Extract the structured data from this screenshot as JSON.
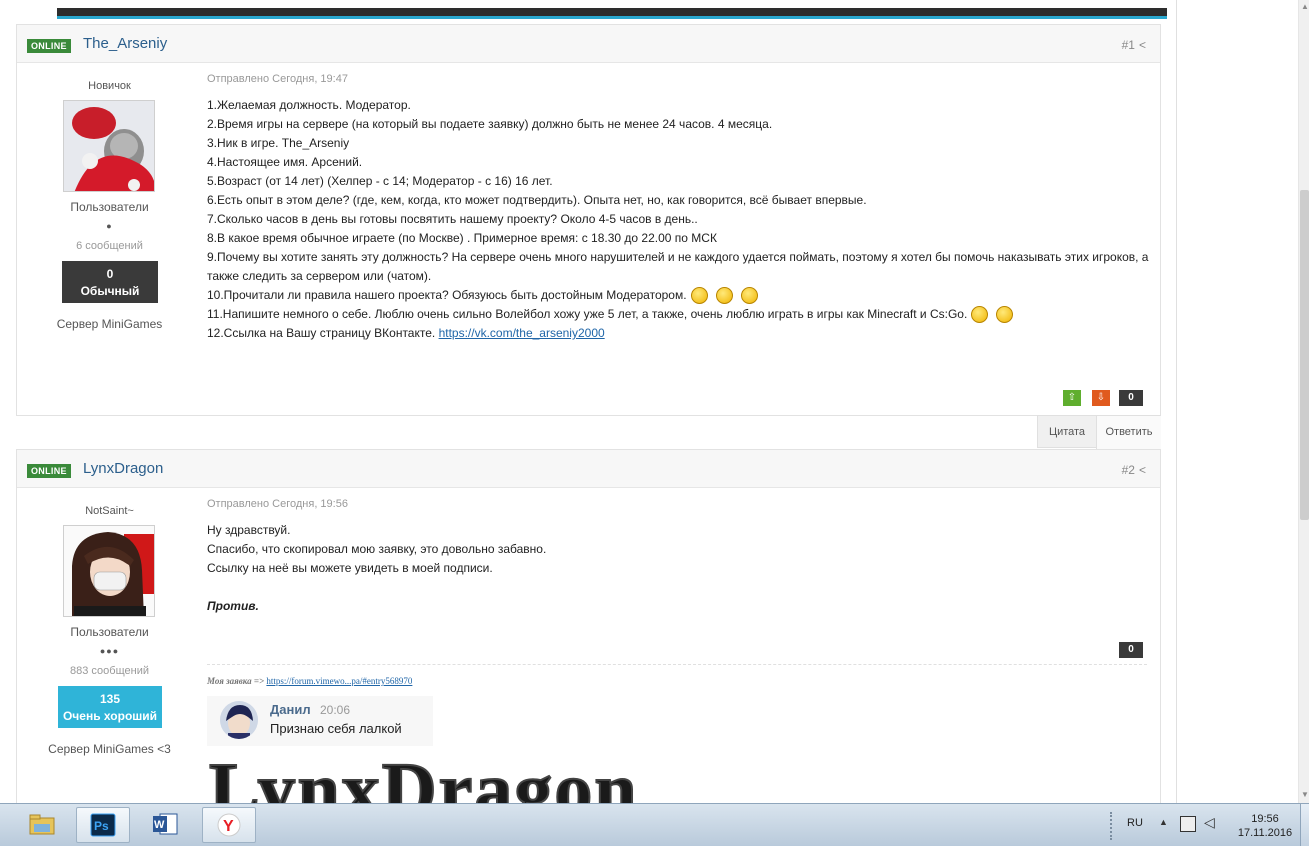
{
  "posts": [
    {
      "online": "ONLINE",
      "username": "The_Arseniy",
      "number": "#1",
      "rank": "Новичок",
      "group": "Пользователи",
      "pips": "●",
      "post_count": "6 сообщений",
      "rep_value": "0",
      "rep_label": "Обычный",
      "rep_color": "#3a3a3a",
      "server": "Сервер MiniGames",
      "posted": "Отправлено Сегодня, 19:47",
      "lines": [
        "1.Желаемая должность. Модератор.",
        "2.Время игры на сервере (на который вы подаете заявку) должно быть не менее 24 часов. 4 месяца.",
        "3.Ник в игре. The_Arseniy",
        "4.Настоящее имя. Арсений.",
        "5.Возраст (от 14 лет) (Хелпер - с 14; Модератор - с 16) 16 лет.",
        "6.Есть опыт в этом деле? (где, кем, когда, кто может подтвердить). Опыта нет, но, как говорится, всё бывает впервые.",
        "7.Сколько часов в день вы готовы посвятить нашему проекту? Около 4-5 часов в день..",
        "8.В какое время обычное играете (по Москве) . Примерное время: с 18.30 до 22.00 по МСК",
        "9.Почему вы хотите занять эту должность? На сервере очень много нарушителей и не каждого удается поймать, поэтому я хотел бы помочь наказывать этих игроков, а",
        "также следить за сервером или (чатом).",
        "10.Прочитали ли правила нашего проекта? Обязуюсь быть достойным Модератором.",
        "11.Напишите немного о себе. Люблю очень сильно Волейбол хожу уже 5 лет, а также, очень люблю играть в игры как Minecraft и Cs:Go."
      ],
      "line12_text": "12.Ссылка на Вашу страницу ВКонтакте. ",
      "line12_link": "https://vk.com/the_arseniy2000",
      "post_rep": "0",
      "vote_up": "⇧",
      "vote_down": "⇩"
    },
    {
      "online": "ONLINE",
      "username": "LynxDragon",
      "number": "#2",
      "rank": "NotSaint~",
      "group": "Пользователи",
      "pips": "●●●",
      "post_count": "883 сообщений",
      "rep_value": "135",
      "rep_label": "Очень хороший",
      "rep_color": "#2fb4d8",
      "server": "Сервер MiniGames <3",
      "posted": "Отправлено Сегодня, 19:56",
      "lines": [
        "Ну здравствуй.",
        "Спасибо, что скопировал мою заявку, это довольно забавно.",
        "Ссылку на неё вы можете увидеть в моей подписи."
      ],
      "bold": "Против.",
      "post_rep": "0",
      "sig_prefix": "Моя заявка => ",
      "sig_link": "https://forum.vimewo...pa/#entry568970",
      "sig_chat_name": "Данил",
      "sig_chat_time": "20:06",
      "sig_chat_text": "Признаю себя лалкой",
      "sig_banner": "LynxDragon"
    }
  ],
  "controls": {
    "quote": "Цитата",
    "reply": "Ответить"
  },
  "taskbar": {
    "lang": "RU",
    "time": "19:56",
    "date": "17.11.2016"
  }
}
